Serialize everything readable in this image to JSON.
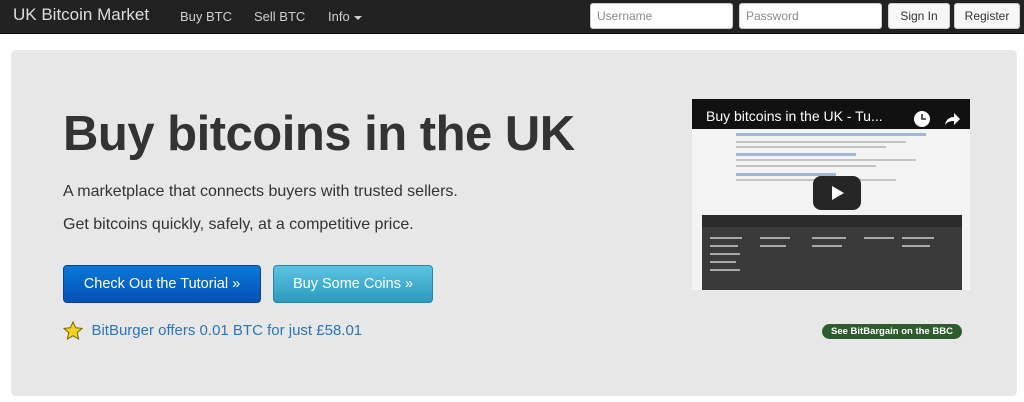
{
  "navbar": {
    "brand": "UK Bitcoin Market",
    "links": [
      "Buy BTC",
      "Sell BTC",
      "Info"
    ],
    "username_placeholder": "Username",
    "password_placeholder": "Password",
    "signin_label": "Sign In",
    "register_label": "Register"
  },
  "hero": {
    "headline": "Buy bitcoins in the UK",
    "lead1": "A marketplace that connects buyers with trusted sellers.",
    "lead2": "Get bitcoins quickly, safely, at a competitive price.",
    "tutorial_button": "Check Out the Tutorial »",
    "buy_button": "Buy Some Coins »",
    "offer_text": "BitBurger offers 0.01 BTC for just £58.01"
  },
  "video": {
    "title": "Buy bitcoins in the UK - Tu...",
    "icons": [
      "clock-icon",
      "share-icon",
      "play-icon"
    ]
  },
  "bbc_badge": "See BitBargain on the BBC",
  "colors": {
    "navbar": "#222222",
    "jumbotron": "#e7e7e7",
    "primary": "#0a64c8",
    "info": "#46b0d4",
    "link": "#2a76ba",
    "badge": "#2e5c2e",
    "star": "#f4d31c"
  }
}
